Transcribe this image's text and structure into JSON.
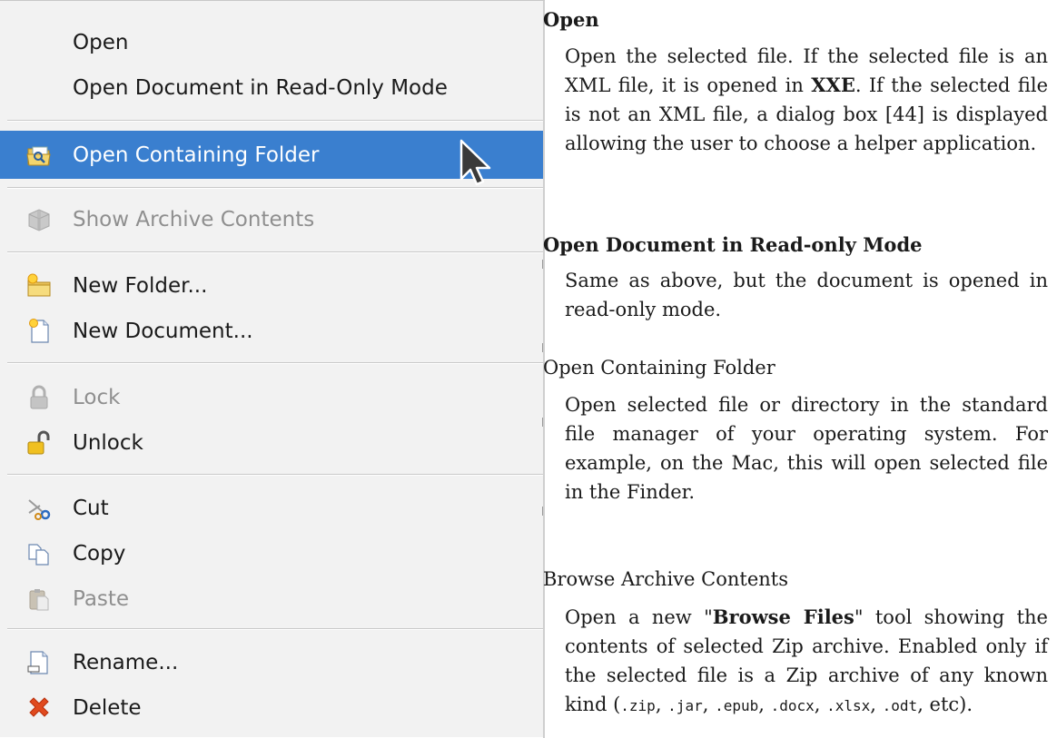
{
  "menu": {
    "items": [
      {
        "label": "Open",
        "icon": "none",
        "disabled": false
      },
      {
        "label": "Open Document in Read-Only Mode",
        "icon": "none",
        "disabled": false
      },
      {
        "label": "Open Containing Folder",
        "icon": "open-folder-icon",
        "disabled": false,
        "highlighted": true
      },
      {
        "label": "Show Archive Contents",
        "icon": "archive-box-icon",
        "disabled": true
      },
      {
        "label": "New Folder...",
        "icon": "new-folder-icon",
        "disabled": false
      },
      {
        "label": "New Document...",
        "icon": "new-document-icon",
        "disabled": false
      },
      {
        "label": "Lock",
        "icon": "lock-icon",
        "disabled": true
      },
      {
        "label": "Unlock",
        "icon": "unlock-icon",
        "disabled": false
      },
      {
        "label": "Cut",
        "icon": "scissors-icon",
        "disabled": false
      },
      {
        "label": "Copy",
        "icon": "copy-icon",
        "disabled": false
      },
      {
        "label": "Paste",
        "icon": "paste-icon",
        "disabled": true
      },
      {
        "label": "Rename...",
        "icon": "rename-icon",
        "disabled": false
      },
      {
        "label": "Delete",
        "icon": "delete-x-icon",
        "disabled": false
      }
    ],
    "highlight_color": "#3a7fcf"
  },
  "doc": {
    "open": {
      "term": "Open",
      "def_1": "Open the selected file. If the selected file is an XML file, it is opened in ",
      "def_app": "XXE",
      "def_2": ". If the selected file is not an XML file, a dialog box [44] is displayed allowing the user to choose a helper application."
    },
    "readonly": {
      "term": "Open Document in Read-only Mode",
      "def": "Same as above, but the document is opened in read-only mode."
    },
    "containing": {
      "term": "Open Containing Folder",
      "def": "Open selected file or directory in the standard file manager of your operating system. For example, on the Mac, this will open selected file in the Finder."
    },
    "archive": {
      "term": "Browse Archive Contents",
      "def_1": "Open a new \"",
      "def_tool": "Browse Files",
      "def_2": "\" tool showing the contents of selected Zip archive. Enabled only if the selected file is a Zip archive of any known kind (",
      "ext_zip": ".zip",
      "sep_1": ", ",
      "ext_jar": ".jar",
      "sep_2": ", ",
      "ext_epub": ".epub",
      "sep_3": ", ",
      "ext_docx": ".docx",
      "sep_4": ", ",
      "ext_xlsx": ".xlsx",
      "sep_5": ", ",
      "ext_odt": ".odt",
      "def_3": ", etc)."
    }
  }
}
